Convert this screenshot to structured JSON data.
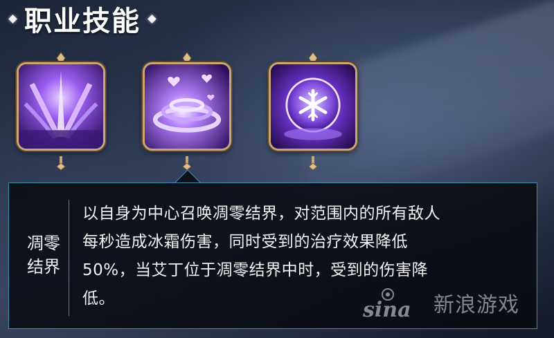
{
  "section": {
    "title": "职业技能"
  },
  "skills": [
    {
      "icon": "purple-claw-icon"
    },
    {
      "icon": "purple-vortex-hearts-icon"
    },
    {
      "icon": "snowflake-orb-icon"
    }
  ],
  "tooltip": {
    "name_line1": "凋零",
    "name_line2": "结界",
    "description_lines": [
      "以自身为中心召唤凋零结界，对范围内的所有敌人",
      "每秒造成冰霜伤害，同时受到的治疗效果降低",
      "50%，当艾丁位于凋零结界中时，受到的伤害降",
      "低。"
    ]
  },
  "watermark": {
    "logo": "sina",
    "text": "新浪游戏"
  },
  "colors": {
    "frame_gold": "#c9a77a",
    "tooltip_border": "#3d8fb1",
    "skill_purple": "#8a4fe0"
  }
}
